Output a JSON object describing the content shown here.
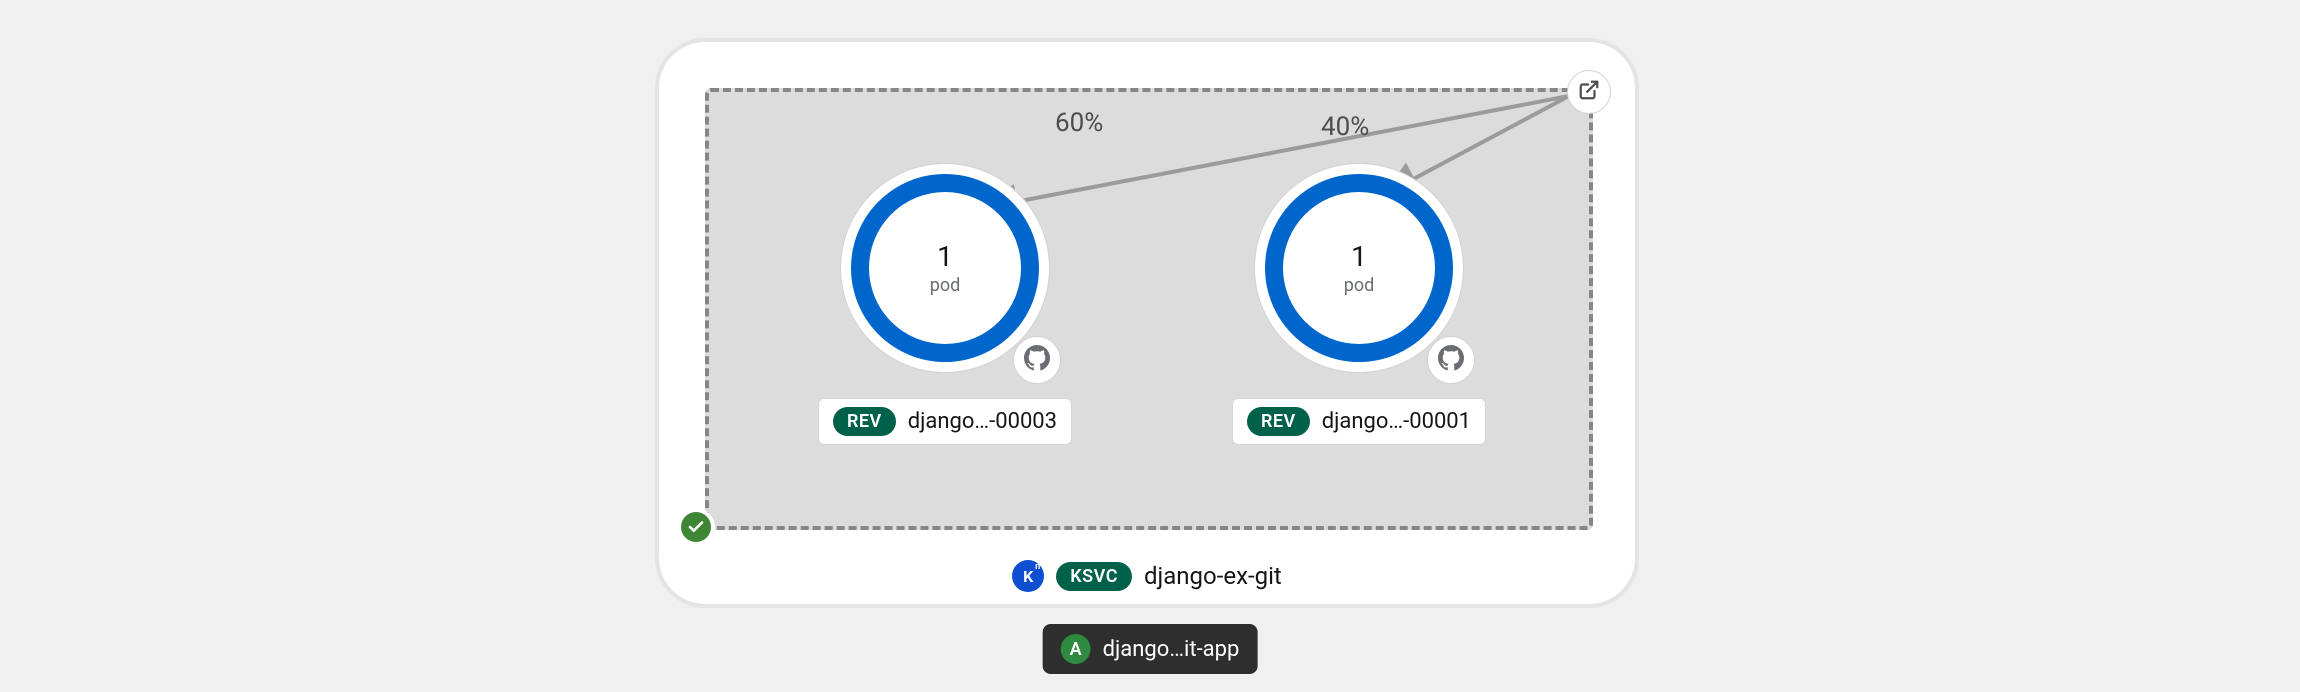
{
  "service": {
    "kind_label": "KSVC",
    "name": "django-ex-git",
    "kn_icon_letter": "K",
    "kn_icon_sup": "n"
  },
  "app": {
    "letter": "A",
    "name": "django…it-app"
  },
  "status": {
    "success": true
  },
  "traffic": {
    "left_pct": "60%",
    "right_pct": "40%"
  },
  "revisions": [
    {
      "kind_label": "REV",
      "name": "django…-00003",
      "pod_count": "1",
      "pod_label": "pod"
    },
    {
      "kind_label": "REV",
      "name": "django…-00001",
      "pod_count": "1",
      "pod_label": "pod"
    }
  ]
}
